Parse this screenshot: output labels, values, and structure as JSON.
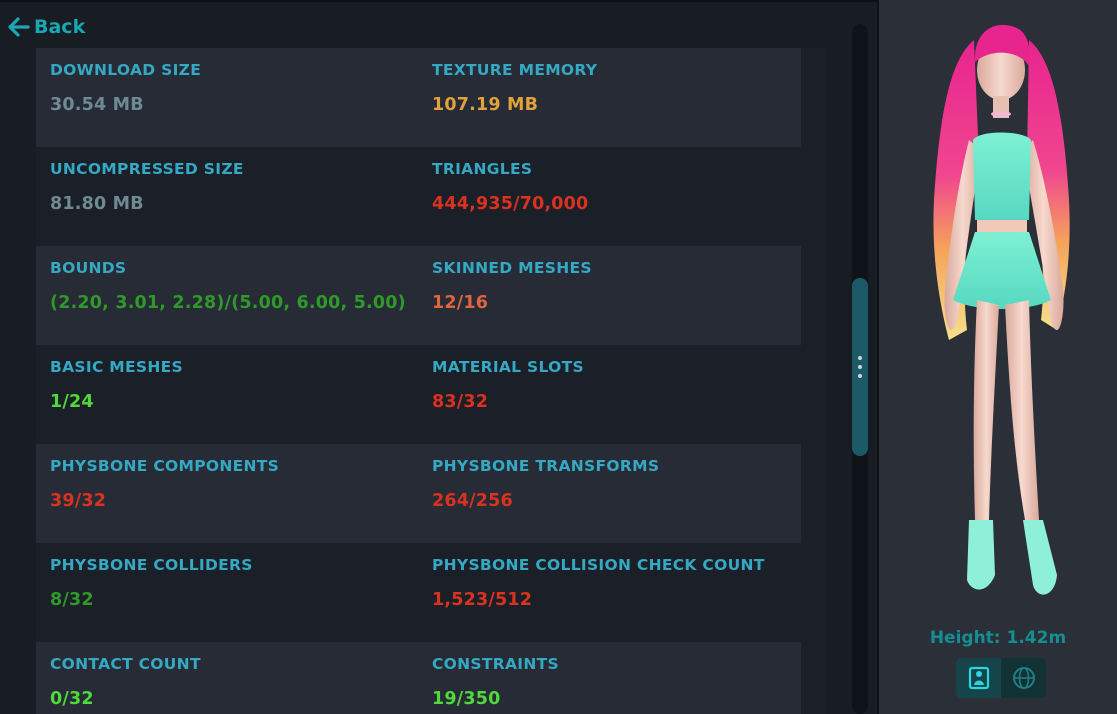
{
  "nav": {
    "back_label": "Back"
  },
  "stats": [
    {
      "left": {
        "label": "DOWNLOAD SIZE",
        "value": "30.54 MB",
        "color": "#6e8a92"
      },
      "right": {
        "label": "TEXTURE MEMORY",
        "value": "107.19 MB",
        "color": "#e0a23a"
      }
    },
    {
      "left": {
        "label": "UNCOMPRESSED SIZE",
        "value": "81.80 MB",
        "color": "#6e8a92"
      },
      "right": {
        "label": "TRIANGLES",
        "value": "444,935/70,000",
        "color": "#d9331f"
      }
    },
    {
      "left": {
        "label": "BOUNDS",
        "value": "(2.20, 3.01, 2.28)/(5.00, 6.00, 5.00)",
        "color": "#2f9a2a"
      },
      "right": {
        "label": "SKINNED MESHES",
        "value": "12/16",
        "color": "#e0643f"
      }
    },
    {
      "left": {
        "label": "BASIC MESHES",
        "value": "1/24",
        "color": "#4fd93a"
      },
      "right": {
        "label": "MATERIAL SLOTS",
        "value": "83/32",
        "color": "#d9331f"
      }
    },
    {
      "left": {
        "label": "PHYSBONE COMPONENTS",
        "value": "39/32",
        "color": "#d9331f"
      },
      "right": {
        "label": "PHYSBONE TRANSFORMS",
        "value": "264/256",
        "color": "#d9331f"
      }
    },
    {
      "left": {
        "label": "PHYSBONE COLLIDERS",
        "value": "8/32",
        "color": "#2f9a2a"
      },
      "right": {
        "label": "PHYSBONE COLLISION CHECK COUNT",
        "value": "1,523/512",
        "color": "#d9331f"
      }
    },
    {
      "left": {
        "label": "CONTACT COUNT",
        "value": "0/32",
        "color": "#4fd93a"
      },
      "right": {
        "label": "CONSTRAINTS",
        "value": "19/350",
        "color": "#4fd93a"
      }
    }
  ],
  "preview": {
    "height_label": "Height: 1.42m",
    "accent_color": "#138f93",
    "toggle_icons": [
      "avatar-stand-icon",
      "globe-icon"
    ]
  }
}
